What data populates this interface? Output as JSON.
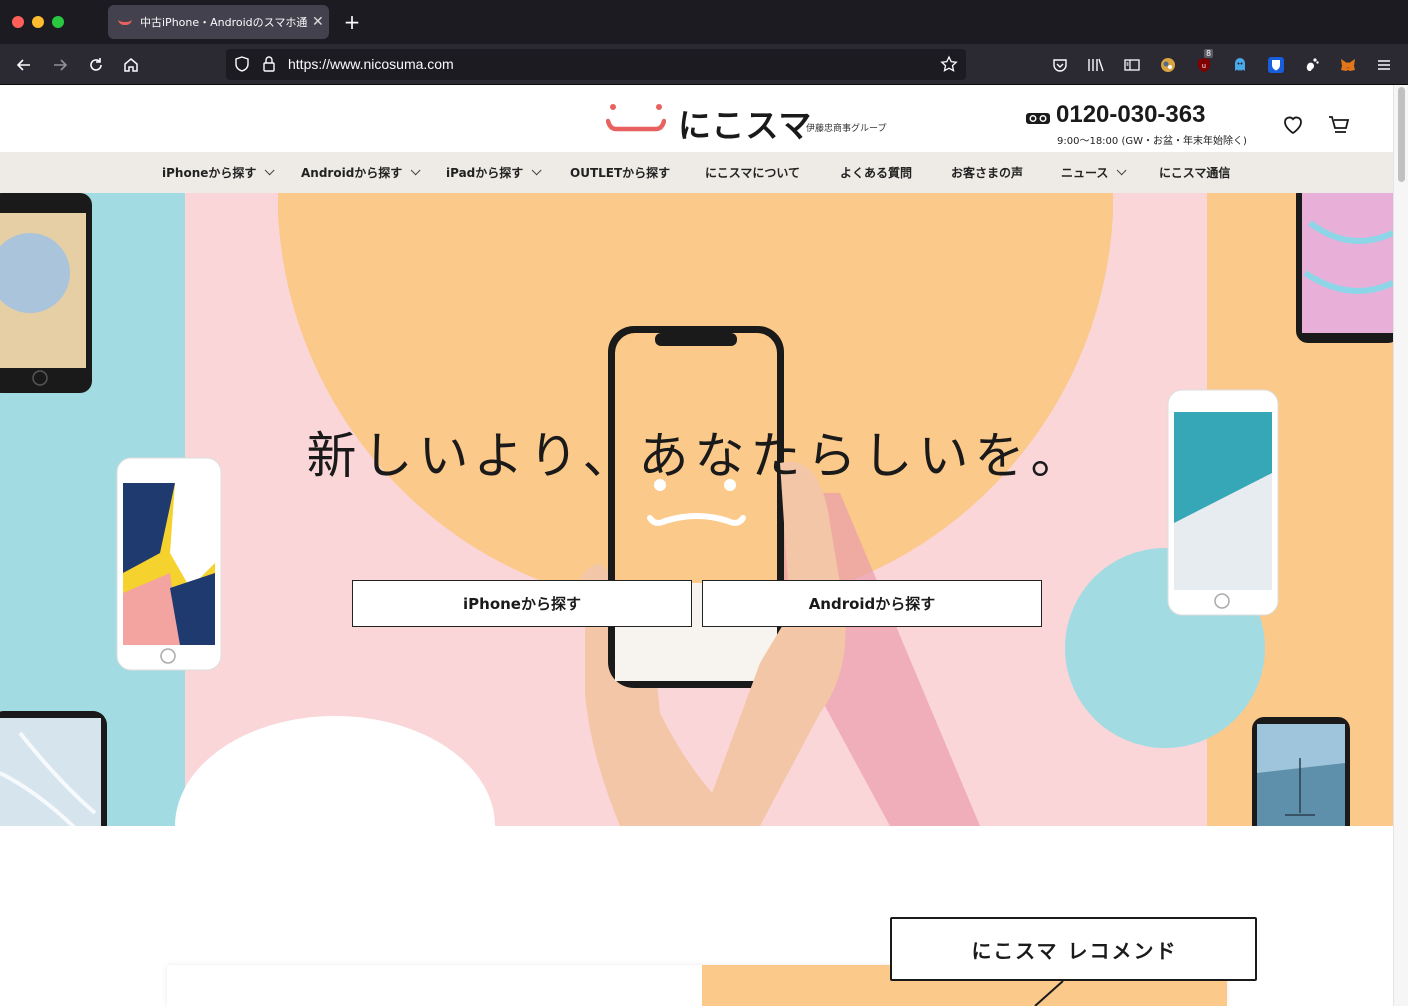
{
  "browser": {
    "tab_title": "中古iPhone・Androidのスマホ通販",
    "tab_close": "✕",
    "new_tab": "+",
    "url": "https://www.nicosuma.com",
    "badge_count": "8"
  },
  "header": {
    "logo_text": "にこスマ",
    "logo_sub": "伊藤忠商事グループ",
    "phone": "0120-030-363",
    "hours": "9:00〜18:00 (GW・お盆・年末年始除く)"
  },
  "nav": {
    "items": [
      {
        "label": "iPhoneから探す",
        "dropdown": true
      },
      {
        "label": "Androidから探す",
        "dropdown": true
      },
      {
        "label": "iPadから探す",
        "dropdown": true
      },
      {
        "label": "OUTLETから探す",
        "dropdown": false
      },
      {
        "label": "にこスマについて",
        "dropdown": false
      },
      {
        "label": "よくある質問",
        "dropdown": false
      },
      {
        "label": "お客さまの声",
        "dropdown": false
      },
      {
        "label": "ニュース",
        "dropdown": true
      },
      {
        "label": "にこスマ通信",
        "dropdown": false
      }
    ]
  },
  "hero": {
    "tagline": "新しいより、あなたらしいを。",
    "btn_iphone": "iPhoneから探す",
    "btn_android": "Androidから探す"
  },
  "recommend": {
    "label": "にこスマ レコメンド"
  },
  "colors": {
    "brand_coral": "#e8615e",
    "hero_pink": "#fad6d9",
    "hero_orange": "#fbc98a",
    "hero_blue": "#a3dbe3",
    "nav_bg": "#eeebe6"
  }
}
